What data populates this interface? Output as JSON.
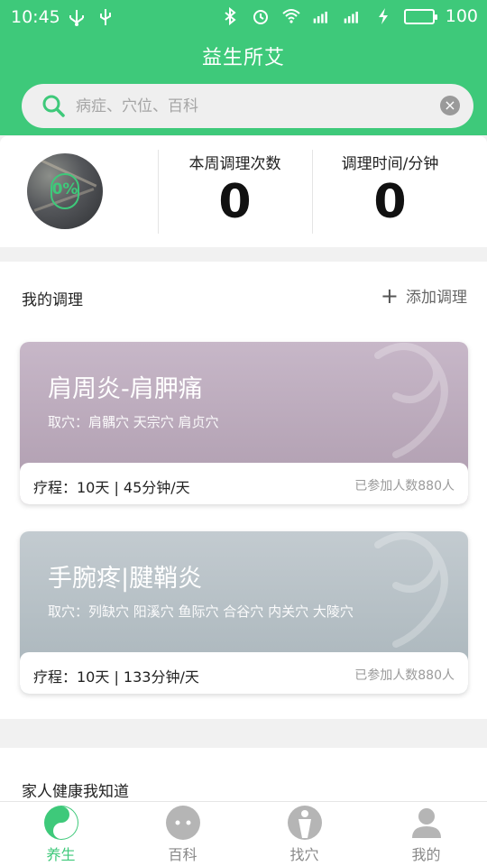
{
  "status_bar": {
    "time": "10:45",
    "battery": "100",
    "network": "4G"
  },
  "app_title": "益生所艾",
  "search": {
    "placeholder": "病症、穴位、百科"
  },
  "stats": {
    "progress_text": "0%",
    "weekly_count_label": "本周调理次数",
    "weekly_count_value": "0",
    "minutes_label": "调理时间/分钟",
    "minutes_value": "0"
  },
  "my_regimen": {
    "title": "我的调理",
    "add_label": "添加调理",
    "cards": [
      {
        "title": "肩周炎-肩胛痛",
        "points": "取穴：肩髃穴 天宗穴 肩贞穴",
        "course": "疗程：10天 | 45分钟/天",
        "participants": "已参加人数880人",
        "color": "#b6a4b6"
      },
      {
        "title": "手腕疼|腱鞘炎",
        "points": "取穴：列缺穴 阳溪穴 鱼际穴 合谷穴 内关穴 大陵穴",
        "course": "疗程：10天 | 133分钟/天",
        "participants": "已参加人数880人",
        "color": "#aeb9bf"
      }
    ]
  },
  "family_section": {
    "title": "家人健康我知道"
  },
  "tabs": [
    {
      "label": "养生",
      "icon": "yin-yang-icon",
      "active": true
    },
    {
      "label": "百科",
      "icon": "chat-bubble-icon",
      "active": false
    },
    {
      "label": "找穴",
      "icon": "body-figure-icon",
      "active": false
    },
    {
      "label": "我的",
      "icon": "person-icon",
      "active": false
    }
  ],
  "colors": {
    "primary": "#3ec97a",
    "inactive": "#888888"
  }
}
